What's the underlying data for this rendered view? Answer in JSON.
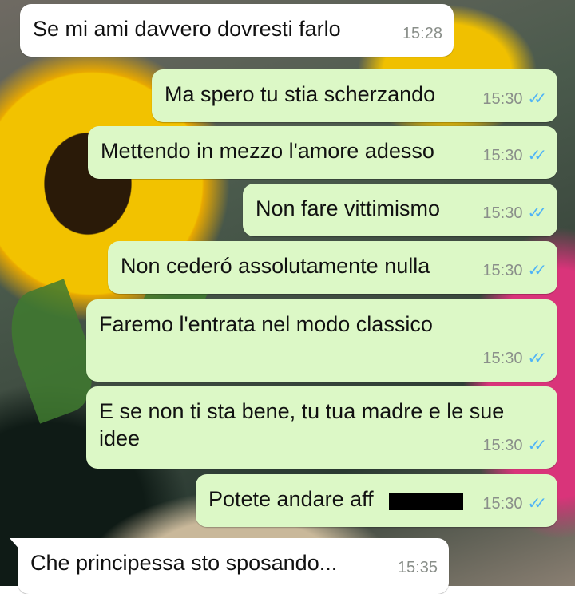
{
  "chat": {
    "messages": [
      {
        "direction": "in",
        "text": "Se mi ami davvero dovresti farlo",
        "time": "15:28"
      },
      {
        "direction": "out",
        "text": "Ma spero tu stia scherzando",
        "time": "15:30",
        "status": "read"
      },
      {
        "direction": "out",
        "text": "Mettendo in mezzo l'amore adesso",
        "time": "15:30",
        "status": "read"
      },
      {
        "direction": "out",
        "text": "Non fare vittimismo",
        "time": "15:30",
        "status": "read"
      },
      {
        "direction": "out",
        "text": "Non cederó assolutamente nulla",
        "time": "15:30",
        "status": "read"
      },
      {
        "direction": "out",
        "text": "Faremo l'entrata nel modo classico",
        "time": "15:30",
        "status": "read"
      },
      {
        "direction": "out",
        "text": "E se non ti sta bene, tu tua madre e le sue idee",
        "time": "15:30",
        "status": "read"
      },
      {
        "direction": "out",
        "text": "Potete andare aff",
        "time": "15:30",
        "status": "read",
        "redacted": true
      },
      {
        "direction": "in",
        "text": "Che principessa sto sposando...",
        "time": "15:35"
      }
    ],
    "read_tick_icon": "double-check-icon",
    "colors": {
      "outgoing": "#dcf8c6",
      "incoming": "#ffffff",
      "read_ticks": "#4fb3f6"
    }
  }
}
